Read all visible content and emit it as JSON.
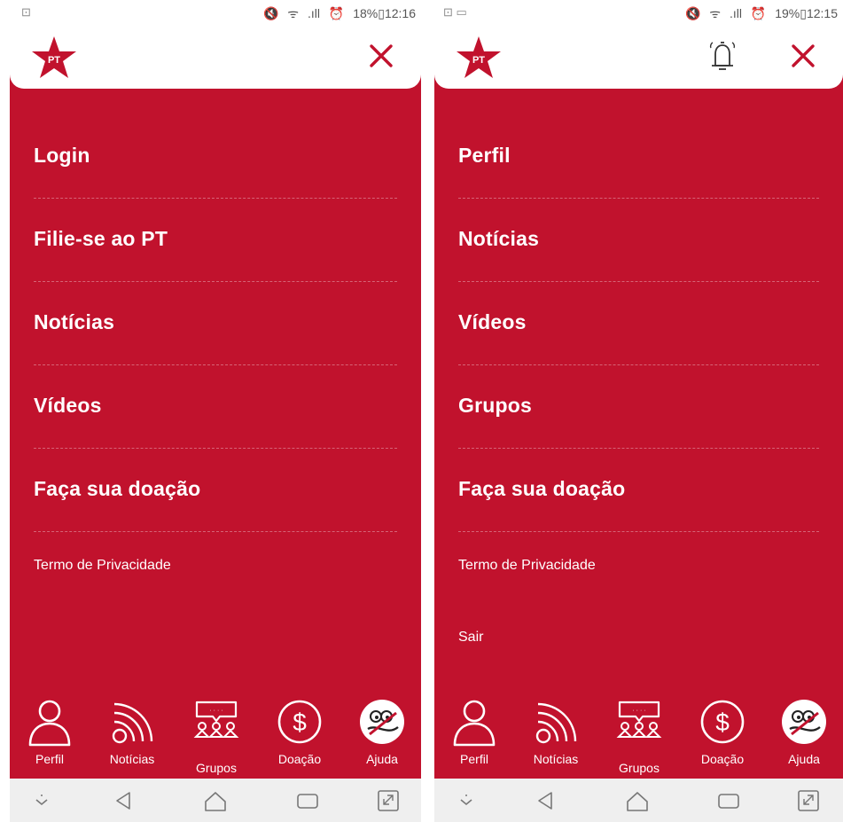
{
  "screens": [
    {
      "status": {
        "left_icons": "⊡",
        "battery": "18%",
        "time": "12:16"
      },
      "header": {
        "logo_text": "PT"
      },
      "menu": [
        "Login",
        "Filie-se ao PT",
        "Notícias",
        "Vídeos",
        "Faça sua doação"
      ],
      "privacy": "Termo de Privacidade",
      "nav": [
        {
          "label": "Perfil",
          "icon": "person-icon"
        },
        {
          "label": "Notícias",
          "icon": "rss-icon"
        },
        {
          "label": "Grupos",
          "icon": "group-icon"
        },
        {
          "label": "Doação",
          "icon": "dollar-icon"
        },
        {
          "label": "Ajuda",
          "icon": "help-mascot-icon"
        }
      ]
    },
    {
      "status": {
        "left_icons": "⊡ ▭",
        "battery": "19%",
        "time": "12:15"
      },
      "header": {
        "logo_text": "PT"
      },
      "menu": [
        "Perfil",
        "Notícias",
        "Vídeos",
        "Grupos",
        "Faça sua doação"
      ],
      "privacy": "Termo de Privacidade",
      "logout": "Sair",
      "nav": [
        {
          "label": "Perfil",
          "icon": "person-icon"
        },
        {
          "label": "Notícias",
          "icon": "rss-icon"
        },
        {
          "label": "Grupos",
          "icon": "group-icon"
        },
        {
          "label": "Doação",
          "icon": "dollar-icon"
        },
        {
          "label": "Ajuda",
          "icon": "help-mascot-icon"
        }
      ]
    }
  ],
  "colors": {
    "brand_red": "#c1122d",
    "white": "#ffffff"
  }
}
